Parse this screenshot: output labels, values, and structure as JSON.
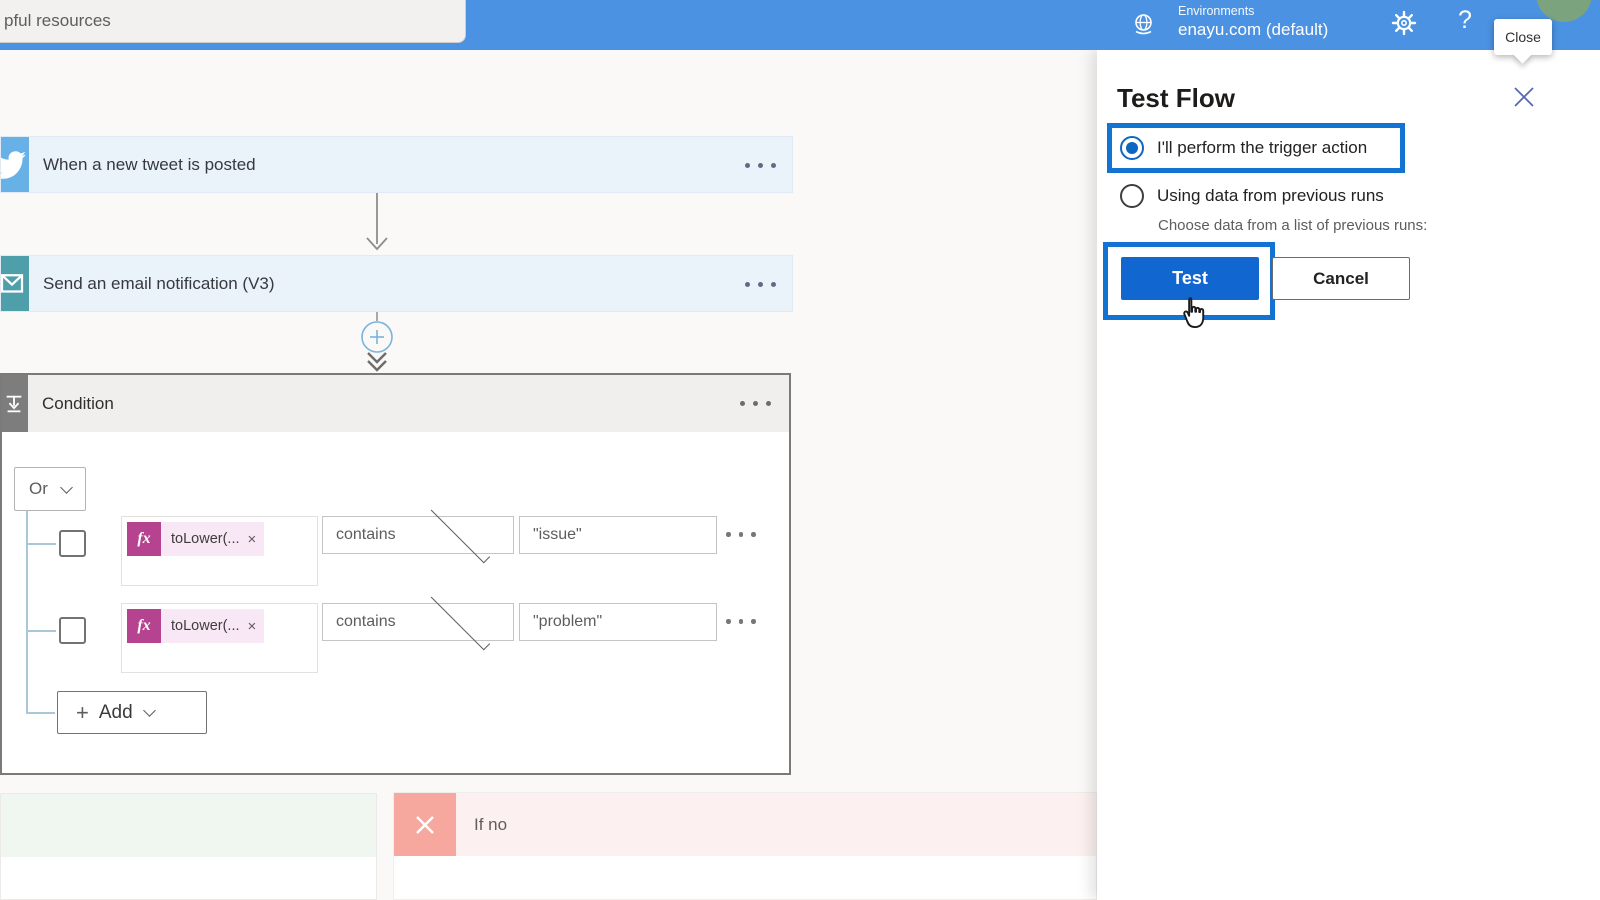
{
  "topbar": {
    "resources_label": "pful resources",
    "environments_label": "Environments",
    "environment_name": "enayu.com (default)",
    "help_label": "?",
    "bar_color": "#4b92e2"
  },
  "tooltip": {
    "close_label": "Close"
  },
  "flow": {
    "trigger": {
      "title": "When a new tweet is posted"
    },
    "action": {
      "title": "Send an email notification (V3)"
    },
    "condition": {
      "title": "Condition",
      "operator": "Or",
      "rows": [
        {
          "expression": "toLower(...",
          "operator": "contains",
          "value": "\"issue\""
        },
        {
          "expression": "toLower(...",
          "operator": "contains",
          "value": "\"problem\""
        }
      ],
      "add_label": "Add"
    },
    "branch_no": {
      "title": "If no"
    }
  },
  "panel": {
    "title": "Test Flow",
    "radio_trigger_label": "I'll perform the trigger action",
    "radio_previous_label": "Using data from previous runs",
    "previous_caption": "Choose data from a list of previous runs:",
    "test_label": "Test",
    "cancel_label": "Cancel",
    "accent_color": "#1273d2"
  },
  "icons": {
    "remove_glyph": "×",
    "plus_glyph": "+"
  }
}
